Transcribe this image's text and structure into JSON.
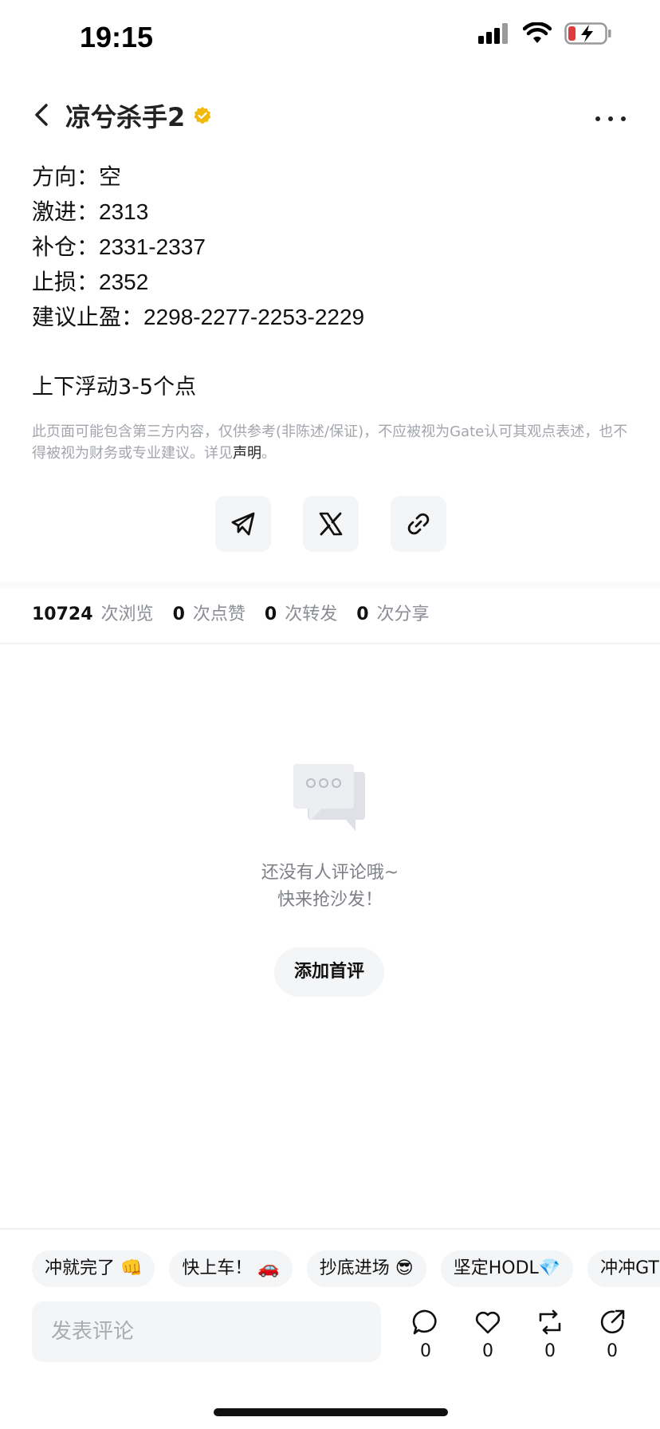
{
  "status": {
    "time": "19:15",
    "battery_color": "#e23b3b"
  },
  "header": {
    "title": "凉兮杀手2"
  },
  "post": {
    "lines": [
      "方向：空",
      "激进：2313",
      "补仓：2331-2337",
      "止损：2352",
      "建议止盈：2298-2277-2253-2229"
    ],
    "note": "上下浮动3-5个点",
    "disclaimer": "此页面可能包含第三方内容，仅供参考(非陈述/保证)，不应被视为Gate认可其观点表述，也不得被视为财务或专业建议。详见",
    "disclaimer_link": "声明",
    "disclaimer_end": "。"
  },
  "share": {
    "icons": [
      "telegram-icon",
      "x-icon",
      "link-icon"
    ]
  },
  "stats": {
    "views_count": "10724",
    "views_label": "次浏览",
    "likes_count": "0",
    "likes_label": "次点赞",
    "reposts_count": "0",
    "reposts_label": "次转发",
    "shares_count": "0",
    "shares_label": "次分享"
  },
  "empty": {
    "line1": "还没有人评论哦~",
    "line2": "快来抢沙发！",
    "add_first": "添加首评"
  },
  "quick_replies": [
    "冲就完了 👊",
    "快上车！ 🚗",
    "抄底进场 😎",
    "坚定HODL💎",
    "冲冲GT"
  ],
  "comment": {
    "placeholder": "发表评论"
  },
  "actions": {
    "comment_count": "0",
    "like_count": "0",
    "repost_count": "0",
    "share_count": "0"
  },
  "colors": {
    "verified": "#f0b90b",
    "muted_text": "#8a8d93",
    "chip_bg": "#f4f5f7"
  }
}
